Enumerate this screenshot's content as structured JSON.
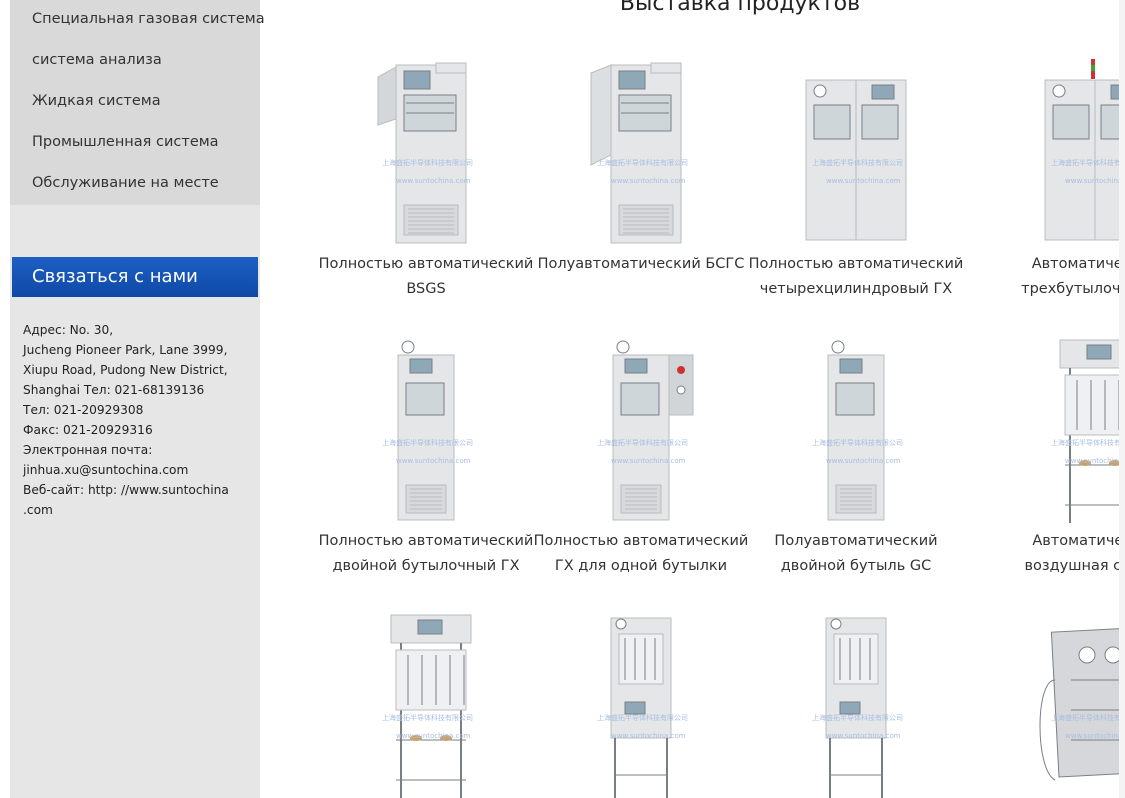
{
  "sidebar": {
    "categories": [
      "Специальная газовая система",
      "система анализа",
      "Жидкая система",
      "Промышленная система",
      "Обслуживание на месте"
    ],
    "contact_title": "Связаться с нами",
    "contact_lines": [
      "Адрес: No. 30,",
      "Jucheng Pioneer Park, Lane 3999,",
      "Xiupu Road, Pudong New District,",
      "Shanghai Тел: 021-68139136",
      "Тел: 021-20929308",
      "Факс: 021-20929316",
      "Электронная почта:",
      "jinhua.xu@suntochina.com",
      "Веб-сайт: http: //www.suntochina",
      ".com"
    ]
  },
  "main": {
    "title": "Выставка продуктов",
    "watermark_cn": "上海盛拓半导体科技有限公司",
    "watermark_url": "www.suntochina.com",
    "products": [
      {
        "line1": "Полностью автоматический",
        "line2": "BSGS"
      },
      {
        "line1": "Полуавтоматический БСГС",
        "line2": ""
      },
      {
        "line1": "Полностью автоматический",
        "line2": "четырехцилиндровый ГХ"
      },
      {
        "line1": "Автоматический",
        "line2": "трехбутылочный Г."
      },
      {
        "line1": "Полностью автоматический",
        "line2": "двойной бутылочный ГХ"
      },
      {
        "line1": "Полностью автоматический",
        "line2": "ГХ для одной бутылки"
      },
      {
        "line1": "Полуавтоматический",
        "line2": "двойной бутыль GC"
      },
      {
        "line1": "Автоматическая",
        "line2": "воздушная стойка"
      },
      {
        "line1": "",
        "line2": ""
      },
      {
        "line1": "",
        "line2": ""
      },
      {
        "line1": "",
        "line2": ""
      },
      {
        "line1": "",
        "line2": ""
      }
    ]
  }
}
